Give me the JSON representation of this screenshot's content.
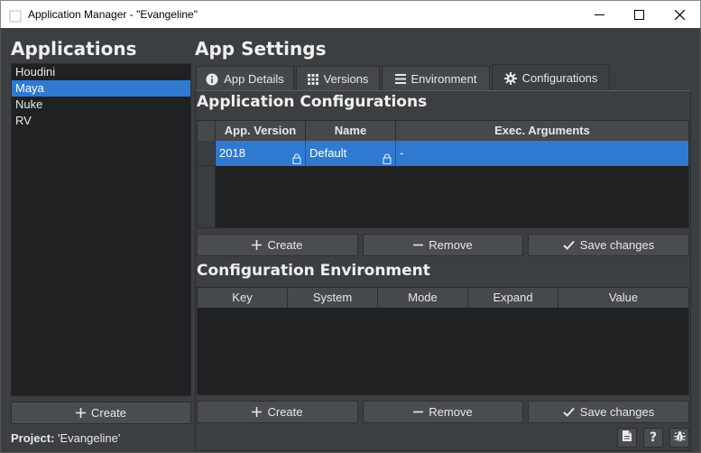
{
  "window": {
    "title": "Application Manager - \"Evangeline\"",
    "minimize_icon": "minimize-icon",
    "maximize_icon": "maximize-icon",
    "close_icon": "close-icon"
  },
  "applications": {
    "heading": "Applications",
    "items": [
      "Houdini",
      "Maya",
      "Nuke",
      "RV"
    ],
    "selected": "Maya",
    "create_label": "Create"
  },
  "settings": {
    "heading": "App Settings",
    "tabs": [
      {
        "label": "App Details",
        "icon": "info-icon"
      },
      {
        "label": "Versions",
        "icon": "grid-icon"
      },
      {
        "label": "Environment",
        "icon": "list-icon"
      },
      {
        "label": "Configurations",
        "icon": "gear-icon"
      }
    ],
    "active_tab": "Configurations"
  },
  "configurations": {
    "heading": "Application Configurations",
    "columns": [
      "App. Version",
      "Name",
      "Exec. Arguments"
    ],
    "rows": [
      {
        "version": "2018",
        "name": "Default",
        "args": "-"
      }
    ],
    "buttons": {
      "create": "Create",
      "remove": "Remove",
      "save": "Save changes"
    }
  },
  "environment": {
    "heading": "Configuration Environment",
    "columns": [
      "Key",
      "System",
      "Mode",
      "Expand",
      "Value"
    ],
    "rows": [],
    "buttons": {
      "create": "Create",
      "remove": "Remove",
      "save": "Save changes"
    }
  },
  "status": {
    "project_label": "Project:",
    "project_value": "'Evangeline'",
    "icons": [
      "document-icon",
      "help-icon",
      "bug-icon"
    ]
  },
  "colors": {
    "background": "#3c3f41",
    "list_background": "#1f2123",
    "selection": "#2f7ad0",
    "header": "#46494c"
  }
}
